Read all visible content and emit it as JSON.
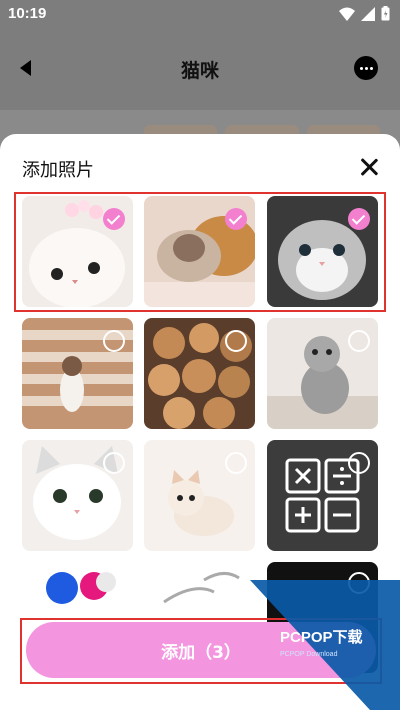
{
  "status": {
    "time": "10:19"
  },
  "header": {
    "title": "猫咪"
  },
  "sheet": {
    "title": "添加照片",
    "add_button": "添加（3）"
  },
  "photos": [
    {
      "selected": true
    },
    {
      "selected": true
    },
    {
      "selected": true
    },
    {
      "selected": false
    },
    {
      "selected": false
    },
    {
      "selected": false
    },
    {
      "selected": false
    },
    {
      "selected": false
    },
    {
      "selected": false
    }
  ],
  "colors": {
    "accent": "#f37fcf",
    "button": "#f495e0",
    "highlight": "#e0322f"
  },
  "watermark": {
    "brand": "PCPOP下载",
    "sub": "PCPOP Download"
  }
}
